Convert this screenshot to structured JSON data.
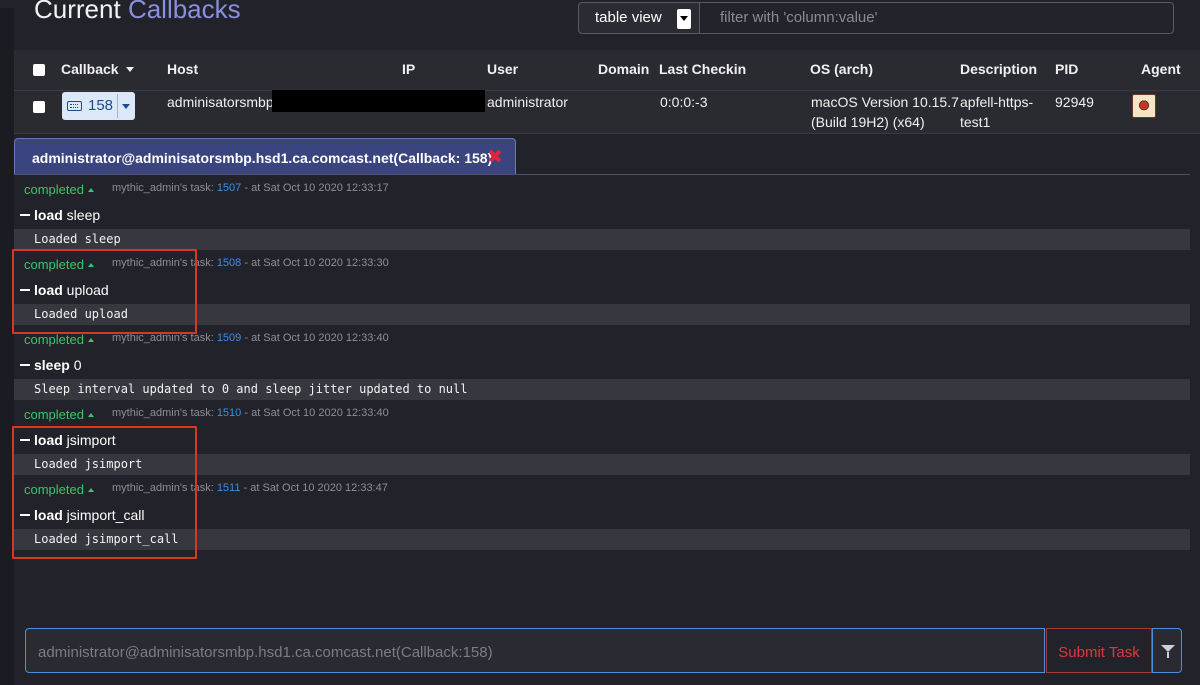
{
  "header": {
    "title_prefix": "Current",
    "title_accent": "Callbacks",
    "view_select_value": "table view",
    "filter_placeholder": "filter with 'column:value'"
  },
  "table": {
    "columns": [
      "Callback",
      "Host",
      "IP",
      "User",
      "Domain",
      "Last Checkin",
      "OS (arch)",
      "Description",
      "PID",
      "Agent"
    ],
    "row": {
      "callback_id": "158",
      "host": "adminisatorsmbp.",
      "ip": "",
      "user": "administrator",
      "domain": "",
      "last_checkin": "0:0:0:-3",
      "os_line1": "macOS Version 10.15.7",
      "os_line2": "(Build 19H2) (x64)",
      "description_line1": "apfell-https-",
      "description_line2": "test1",
      "pid": "92949",
      "agent_icon": "apfell-agent-icon"
    }
  },
  "tab": {
    "label": "administrator@adminisatorsmbp.hsd1.ca.comcast.net(Callback: 158)",
    "close_icon": "close-icon"
  },
  "tasks": [
    {
      "status": "completed",
      "operator_prefix": "mythic_admin's task:",
      "task_id": "1507",
      "time": "- at Sat Oct 10 2020 12:33:17",
      "command": "load",
      "params": "sleep",
      "output": "Loaded sleep"
    },
    {
      "status": "completed",
      "operator_prefix": "mythic_admin's task:",
      "task_id": "1508",
      "time": "- at Sat Oct 10 2020 12:33:30",
      "command": "load",
      "params": "upload",
      "output": "Loaded upload"
    },
    {
      "status": "completed",
      "operator_prefix": "mythic_admin's task:",
      "task_id": "1509",
      "time": "- at Sat Oct 10 2020 12:33:40",
      "command": "sleep",
      "params": "0",
      "output": "Sleep interval updated to 0 and sleep jitter updated to null"
    },
    {
      "status": "completed",
      "operator_prefix": "mythic_admin's task:",
      "task_id": "1510",
      "time": "- at Sat Oct 10 2020 12:33:40",
      "command": "load",
      "params": "jsimport",
      "output": "Loaded jsimport"
    },
    {
      "status": "completed",
      "operator_prefix": "mythic_admin's task:",
      "task_id": "1511",
      "time": "- at Sat Oct 10 2020 12:33:47",
      "command": "load",
      "params": "jsimport_call",
      "output": "Loaded jsimport_call"
    }
  ],
  "task_input": {
    "placeholder": "administrator@adminisatorsmbp.hsd1.ca.comcast.net(Callback:158)",
    "submit_label": "Submit Task",
    "filter_icon": "filter-icon"
  },
  "colors": {
    "status_completed": "#3cc56a",
    "task_id_link": "#3d8fe0",
    "highlight_box": "#d7381f",
    "tab_bg": "#3a4580",
    "submit_text": "#e0383a"
  }
}
